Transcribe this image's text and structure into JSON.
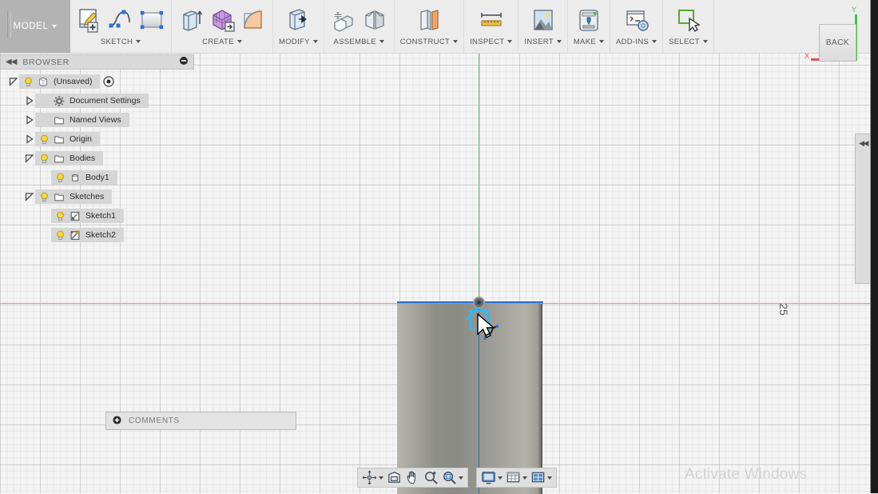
{
  "app": {
    "workspace_button": "MODEL",
    "watermark": "Activate Windows"
  },
  "ribbon": {
    "groups": [
      {
        "label": "SKETCH",
        "icons": [
          "create-sketch-icon",
          "spline-icon",
          "rectangle-icon"
        ]
      },
      {
        "label": "CREATE",
        "icons": [
          "extrude-icon",
          "box-pattern-icon",
          "revolve-icon"
        ]
      },
      {
        "label": "MODIFY",
        "icons": [
          "press-pull-icon"
        ]
      },
      {
        "label": "ASSEMBLE",
        "icons": [
          "new-component-icon",
          "joint-icon"
        ]
      },
      {
        "label": "CONSTRUCT",
        "icons": [
          "offset-plane-icon"
        ]
      },
      {
        "label": "INSPECT",
        "icons": [
          "measure-icon"
        ]
      },
      {
        "label": "INSERT",
        "icons": [
          "insert-image-icon"
        ]
      },
      {
        "label": "MAKE",
        "icons": [
          "3d-print-icon"
        ]
      },
      {
        "label": "ADD-INS",
        "icons": [
          "scripts-addins-icon"
        ]
      },
      {
        "label": "SELECT",
        "icons": [
          "select-icon"
        ]
      }
    ]
  },
  "browser": {
    "title": "BROWSER",
    "collapse_icon": "collapse-left-icon",
    "options_icon": "browser-options-icon",
    "tree": [
      {
        "label": "(Unsaved)",
        "indent": 0,
        "expander": "expanded",
        "bulb": true,
        "icon": "component-icon",
        "extra": "display-state-icon"
      },
      {
        "label": "Document Settings",
        "indent": 1,
        "expander": "collapsed",
        "bulb": false,
        "icon": "gear-icon",
        "extra": ""
      },
      {
        "label": "Named Views",
        "indent": 1,
        "expander": "collapsed",
        "bulb": false,
        "icon": "folder-icon",
        "extra": ""
      },
      {
        "label": "Origin",
        "indent": 1,
        "expander": "collapsed",
        "bulb": true,
        "icon": "folder-icon",
        "extra": ""
      },
      {
        "label": "Bodies",
        "indent": 1,
        "expander": "expanded",
        "bulb": true,
        "icon": "folder-icon",
        "extra": ""
      },
      {
        "label": "Body1",
        "indent": 2,
        "expander": "none",
        "bulb": true,
        "icon": "body-cylinder-icon",
        "extra": ""
      },
      {
        "label": "Sketches",
        "indent": 1,
        "expander": "expanded",
        "bulb": true,
        "icon": "folder-icon",
        "extra": ""
      },
      {
        "label": "Sketch1",
        "indent": 2,
        "expander": "none",
        "bulb": true,
        "icon": "sketch-icon",
        "extra": ""
      },
      {
        "label": "Sketch2",
        "indent": 2,
        "expander": "none",
        "bulb": true,
        "icon": "sketch-edit-icon",
        "extra": ""
      }
    ]
  },
  "comments": {
    "label": "COMMENTS",
    "add_icon": "add-comment-icon"
  },
  "navbar": {
    "group1": [
      {
        "name": "orbit-icon",
        "caret": true
      },
      {
        "name": "look-at-icon",
        "caret": false
      },
      {
        "name": "pan-icon",
        "caret": false
      },
      {
        "name": "zoom-icon",
        "caret": false
      },
      {
        "name": "fit-icon",
        "caret": true
      }
    ],
    "group2": [
      {
        "name": "display-settings-icon",
        "caret": true
      },
      {
        "name": "grid-snaps-icon",
        "caret": true
      },
      {
        "name": "viewports-icon",
        "caret": true
      }
    ]
  },
  "viewcube": {
    "face_label": "BACK",
    "axis_x_label": "X",
    "axis_y_label": "Y"
  },
  "right_panel": {
    "collapse_icon": "collapse-right-icon"
  },
  "canvas": {
    "dimension_label": "25",
    "cursor_icon": "arrow-cursor",
    "tool_glyph": "spline-tool-glyph",
    "colors": {
      "axis_x": "#e8908e",
      "axis_y": "#6fc46c",
      "sketch_line": "#2b6fd6",
      "selection": "#2fb9f2",
      "body": "#97968f"
    }
  }
}
